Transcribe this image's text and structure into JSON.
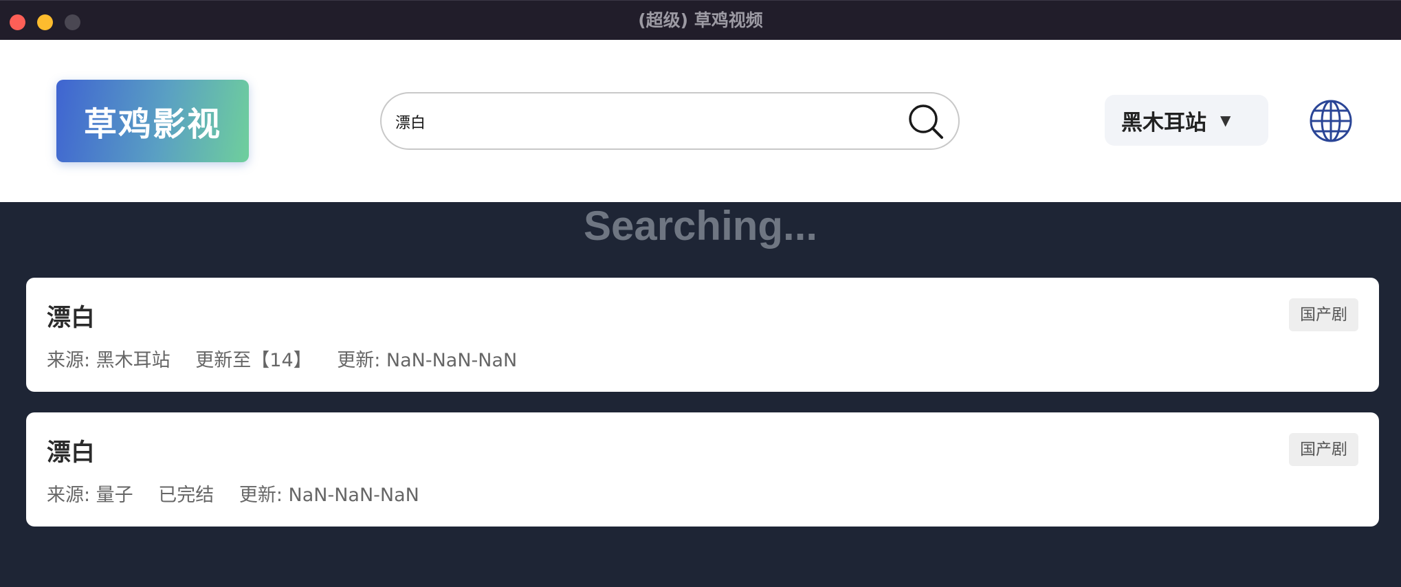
{
  "window": {
    "title": "(超级) 草鸡视频"
  },
  "header": {
    "logo_text": "草鸡影视",
    "search": {
      "value": "漂白",
      "placeholder": ""
    },
    "site_selector": {
      "label": "黑木耳站",
      "caret": "▼"
    },
    "icons": [
      "search-icon",
      "globe-icon"
    ]
  },
  "main": {
    "status_text": "Searching...",
    "results": [
      {
        "title": "漂白",
        "source": "来源: 黑木耳站",
        "episode": "更新至【14】",
        "updated": "更新: NaN-NaN-NaN",
        "tag": "国产剧"
      },
      {
        "title": "漂白",
        "source": "来源: 量子",
        "episode": "已完结",
        "updated": "更新: NaN-NaN-NaN",
        "tag": "国产剧"
      }
    ]
  },
  "colors": {
    "background": "#1e2535",
    "titlebar": "#211d2a",
    "logo_gradient_start": "#3f64d1",
    "logo_gradient_end": "#6fcf9c",
    "globe": "#2a4596"
  }
}
